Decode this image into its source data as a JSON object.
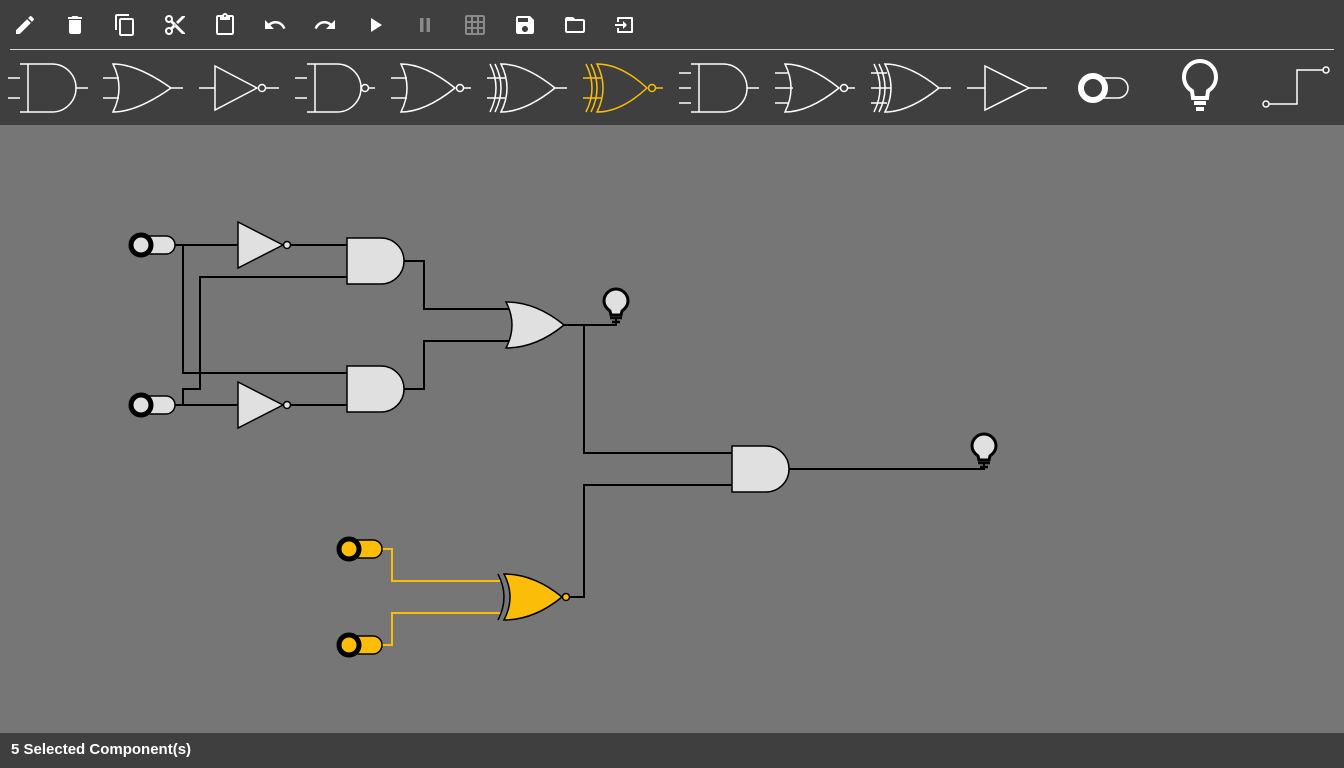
{
  "toolbar": {
    "tools": [
      {
        "id": "edit",
        "icon": "pencil-icon",
        "enabled": true
      },
      {
        "id": "delete",
        "icon": "trash-icon",
        "enabled": true
      },
      {
        "id": "copy",
        "icon": "copy-icon",
        "enabled": true
      },
      {
        "id": "cut",
        "icon": "scissors-icon",
        "enabled": true
      },
      {
        "id": "paste",
        "icon": "clipboard-icon",
        "enabled": true
      },
      {
        "id": "undo",
        "icon": "undo-icon",
        "enabled": true
      },
      {
        "id": "redo",
        "icon": "redo-icon",
        "enabled": true
      },
      {
        "id": "run",
        "icon": "play-icon",
        "enabled": true
      },
      {
        "id": "pause",
        "icon": "pause-icon",
        "enabled": false
      },
      {
        "id": "grid",
        "icon": "grid-icon",
        "enabled": false
      },
      {
        "id": "save",
        "icon": "save-icon",
        "enabled": true
      },
      {
        "id": "open",
        "icon": "folder-icon",
        "enabled": true
      },
      {
        "id": "export",
        "icon": "export-icon",
        "enabled": true
      }
    ]
  },
  "palette": {
    "items": [
      {
        "id": "and",
        "icon": "and-gate-icon",
        "selected": false
      },
      {
        "id": "or",
        "icon": "or-gate-icon",
        "selected": false
      },
      {
        "id": "not",
        "icon": "not-gate-icon",
        "selected": false
      },
      {
        "id": "nand",
        "icon": "nand-gate-icon",
        "selected": false
      },
      {
        "id": "nor",
        "icon": "nor-gate-icon",
        "selected": false
      },
      {
        "id": "xor",
        "icon": "xor-gate-icon",
        "selected": false
      },
      {
        "id": "xnor",
        "icon": "xnor-gate-icon",
        "selected": true
      },
      {
        "id": "and3",
        "icon": "and-gate-3-input-icon",
        "selected": false
      },
      {
        "id": "nor3",
        "icon": "nor-gate-3-input-icon",
        "selected": false
      },
      {
        "id": "xnor3",
        "icon": "xnor-gate-3-input-icon",
        "selected": false
      },
      {
        "id": "buffer",
        "icon": "buffer-gate-icon",
        "selected": false
      },
      {
        "id": "switch",
        "icon": "toggle-switch-icon",
        "selected": false
      },
      {
        "id": "lamp",
        "icon": "lightbulb-icon",
        "selected": false
      },
      {
        "id": "clock",
        "icon": "clock-signal-icon",
        "selected": false
      }
    ]
  },
  "colors": {
    "chrome": "#3f3f3f",
    "canvas": "#767676",
    "gate_fill": "#e0e0e0",
    "selected": "#fbbd08",
    "disabled_icon": "#8a8a8a"
  },
  "circuit": {
    "selected_components": [
      "switch-c",
      "switch-d",
      "xnor-gate"
    ]
  },
  "status": {
    "text": "5 Selected Component(s)"
  }
}
